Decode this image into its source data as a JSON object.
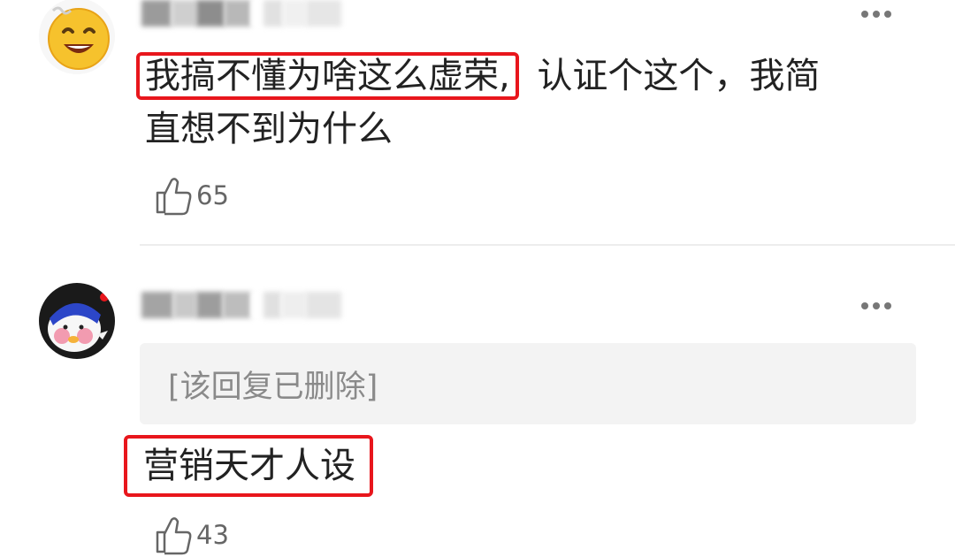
{
  "comments": [
    {
      "avatar_icon": "grinning-emoji-avatar-icon",
      "text_highlighted": "我搞不懂为啥这么虚荣,",
      "text_line1_rest": "认证个这个，我简",
      "text_line2": "直想不到为什么",
      "like_icon": "thumbs-up-icon",
      "likes": "65"
    },
    {
      "avatar_icon": "pink-cartoon-character-avatar-icon",
      "deleted_reply": "[该回复已删除]",
      "reply_text": "营销天才人设",
      "like_icon": "thumbs-up-icon",
      "likes": "43"
    }
  ],
  "colors": {
    "highlight_border": "#e8161c",
    "deleted_bg": "#f3f3f3",
    "text": "#222222",
    "muted": "#666666"
  }
}
